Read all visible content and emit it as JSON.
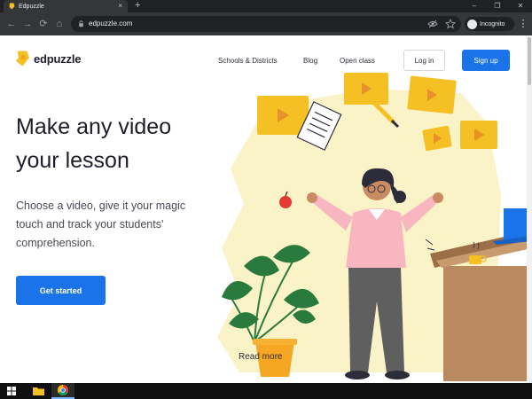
{
  "browser": {
    "tab_title": "Edpuzzle",
    "tab_close": "×",
    "new_tab": "+",
    "window_controls": {
      "minimize": "–",
      "restore": "❐",
      "close": "✕"
    },
    "nav": {
      "back": "←",
      "forward": "→",
      "reload": "⟳",
      "home": "⌂"
    },
    "url": "edpuzzle.com",
    "incognito_label": "Incognito",
    "menu": "⋮",
    "omnibox_icons": [
      "eye-off-icon",
      "star-icon"
    ]
  },
  "header": {
    "brand": "edpuzzle",
    "nav_links": [
      "Schools & Districts",
      "Blog",
      "Open class"
    ],
    "login_label": "Log in",
    "signup_label": "Sign up"
  },
  "hero": {
    "headline_line1": "Make any video",
    "headline_line2": "your lesson",
    "subhead_line1": "Choose a video, give it your magic",
    "subhead_line2": "touch and track your students'",
    "subhead_line3": "comprehension.",
    "cta_label": "Get started",
    "read_more": "Read more"
  },
  "colors": {
    "brand_yellow": "#f5c024",
    "primary_blue": "#1a73e8",
    "hero_blob": "#fbf3c8",
    "sweater_pink": "#f7b6c0",
    "pants_gray": "#5f5f5f",
    "desk_brown": "#b98a5f"
  },
  "taskbar": {
    "items": [
      "windows-start-icon",
      "file-explorer-icon",
      "chrome-icon"
    ]
  }
}
